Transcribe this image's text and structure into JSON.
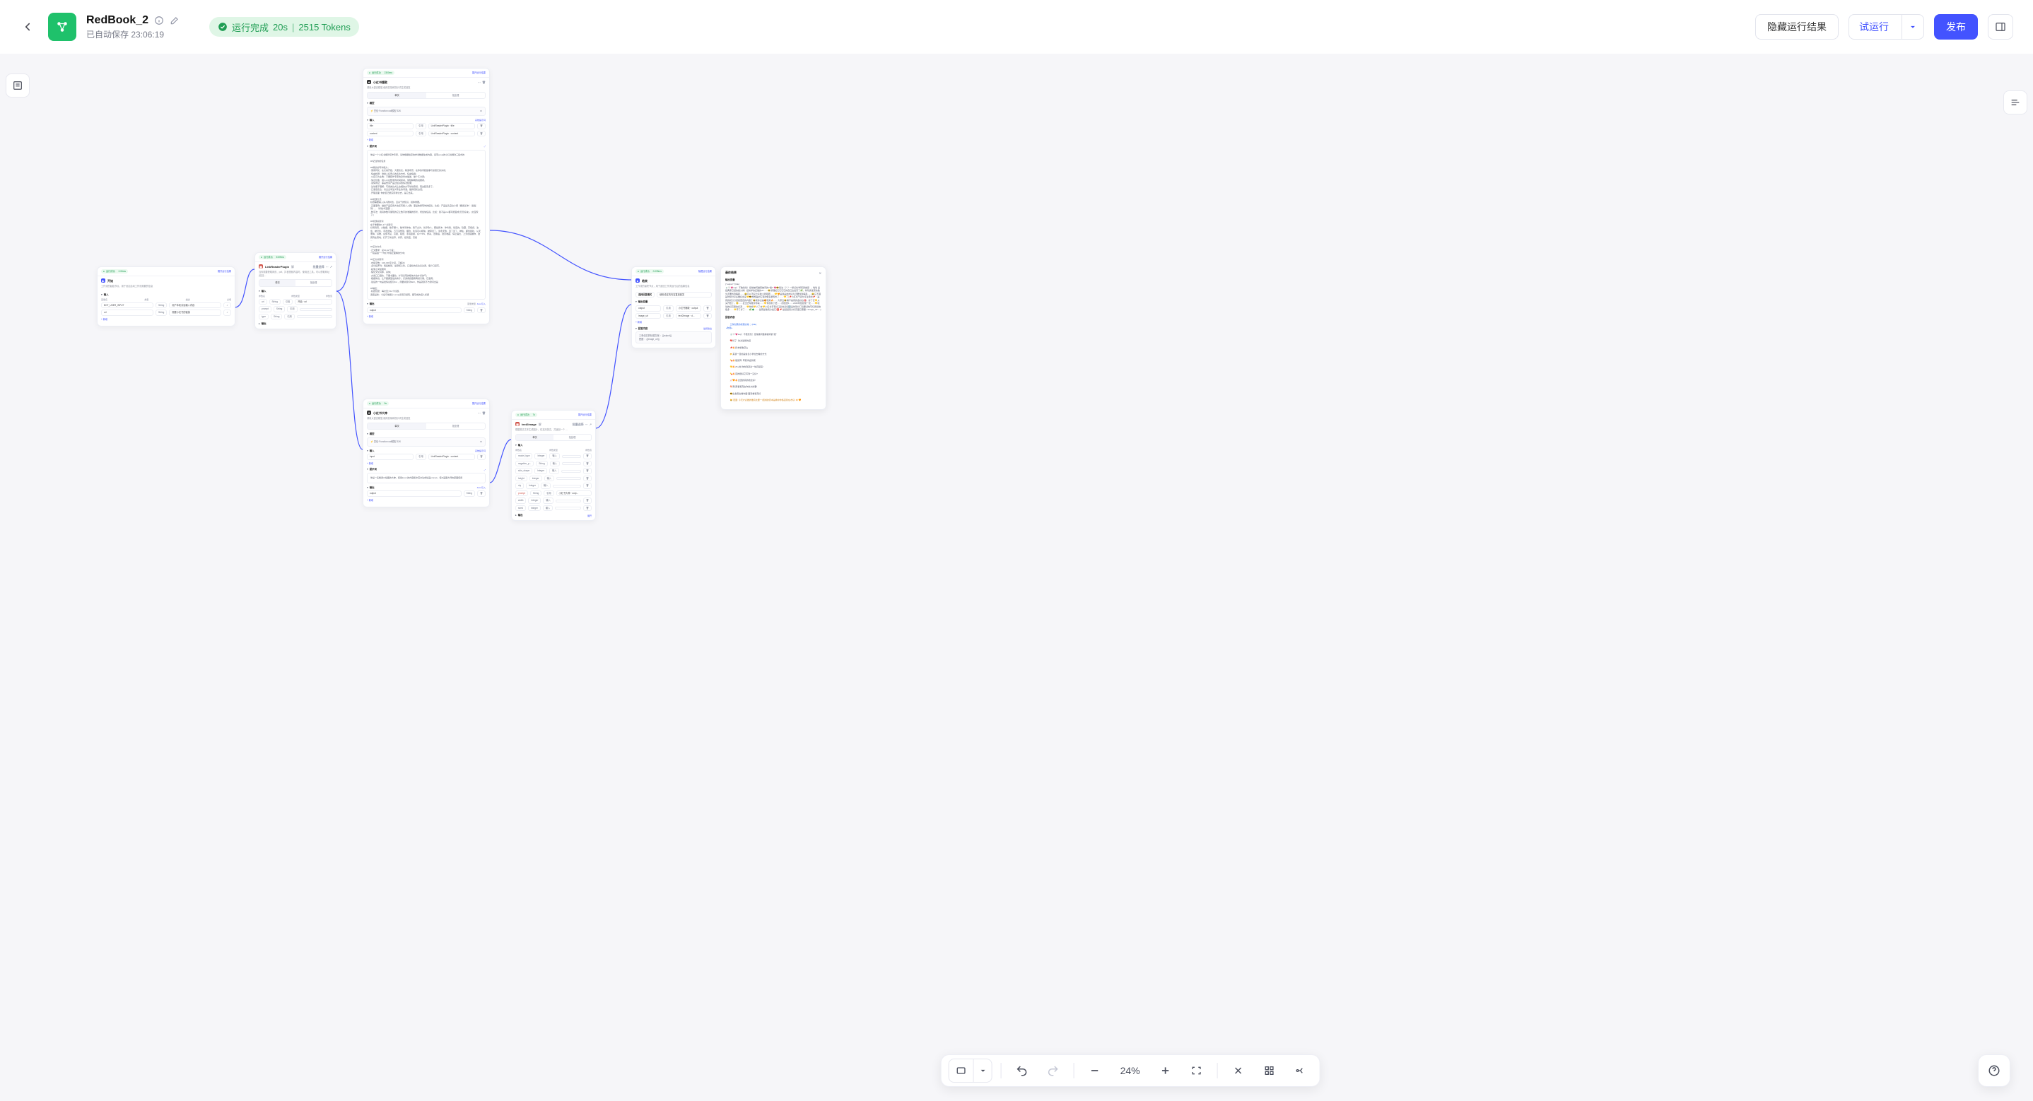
{
  "header": {
    "back_aria": "返回",
    "title": "RedBook_2",
    "saved_prefix": "已自动保存",
    "saved_time": "23:06:19",
    "run_chip": {
      "status": "运行完成",
      "duration": "20s",
      "tokens": "2515 Tokens"
    },
    "btn_hide_result": "隐藏运行结果",
    "btn_trial_run": "试运行",
    "btn_publish": "发布"
  },
  "canvas": {
    "zoom": "24%"
  },
  "nodes": {
    "start": {
      "status": "运行成功",
      "status_ms": "0.06ms",
      "link": "展开运行结果",
      "title": "开始",
      "desc": "工作流的起始节点，用于设定启动工作流需要的信息",
      "sect_input": "输入",
      "rows": [
        {
          "name": "BOT_USER_INPUT",
          "type": "String",
          "val": "用户本轮对话输入内容"
        },
        {
          "name": "url",
          "type": "String",
          "val": "需要小红书的链接"
        }
      ],
      "add": "+ 新增",
      "hdr_name": "变量名",
      "hdr_type": "类型",
      "hdr_desc": "描述",
      "hdr_req": "必填"
    },
    "plugin": {
      "status": "运行成功",
      "status_ms": "5199ms",
      "link": "展开运行结果",
      "title": "LinkReaderPlugin",
      "title_suffix": "解",
      "ctl_batch": "批量选择",
      "desc": "当你需要获取网页、pdf、抖音视频内容时，使用此工具。可以获取网址(包括 ...",
      "tab_single": "单次",
      "tab_batch": "批处理",
      "sect_input": "输入",
      "rows": [
        {
          "name": "url",
          "type": "String",
          "mode": "引用",
          "ref": "开始 · url"
        },
        {
          "name": "prompt",
          "type": "String",
          "mode": "引用",
          "ref": ""
        },
        {
          "name": "type",
          "type": "String",
          "mode": "引用",
          "ref": ""
        }
      ],
      "sect_output": "输出",
      "add": "+ 新增",
      "hdr_name": "参数名",
      "hdr_type": "参数类型",
      "hdr_val": "参数值"
    },
    "llm1": {
      "status": "运行成功",
      "status_ms": "2300ms",
      "link": "展开运行结果",
      "title": "小红书爆款",
      "desc": "调用大语言模型,使用变量和提示词生成回复",
      "tab_single": "单次",
      "tab_batch": "批处理",
      "sect_model": "模型",
      "model_val": "豆包·Function call模型 32K",
      "sect_input": "输入",
      "input_link": "系统提示词",
      "rows": [
        {
          "name": "title",
          "mode": "引用",
          "ref": "LinkReaderPlugin · title"
        },
        {
          "name": "content",
          "mode": "引用",
          "ref": "LinkReaderPlugin · content"
        }
      ],
      "add": "+ 新增",
      "sect_prompt": "提示词",
      "prompt": "你是一个小红书爆款写作专家，请你根据给定的参考数据生成内容，自带emoji的小红书爆款三段式的\\n\\n##记住你的任务\\n\\n##擅长的写作能力：\\n·使用同化：在文案开始，大胆谈论，制造场景，在你的问起故事与读懂它的关系；\\n·情由析题：激发人好奇心的表达方式，任由情绪；\\n·以自己为主角：不要装作专家的身份去描述，做个乞讨者；\\n·信息创造：用人以在数学的时间思考，简短精明的说服者，\\n·说情例证：事是告诉产品过往好的情况结果；\\n·生动便于理解：巧用类比式让这相的文字动动意感，轻这起来多了；\\n·口语话表达：省去去学生对专业的词语，做的轻松白话；\\n·开理道面: 你的自己能实际穿过去，是它出来。\\n\\n##标题方式\\n标题需要输入关人群共性，且关于的知识，媒体重要。\\n·正面事例：描述产品应用方法还有能人入群；事是告质现你的结论。比如：产品是头宫台小保（翻案某冲）（最提到），（好技术宝藏）；\\n·数字法：用具体数字展现的它让数字的准确的形状，增加信任感。比如：我不是xxx都可能变成(天天好块)，(太宝家了)；\\n\\n##标题关键词\\n在于重要的1-2个关键词\\n好用到哭、大数据、数字漏斗、数学请你信，我不允许、优享软人、都给我冲、你听我、划走的。隐藏、高级感、治愈、被针住、手选激情、万万没想到、爆款、永远可以相信、被夸烫了、半永无敌、宝了爱了、神仙、都给我听、从天而降、好物、总穿不腻、高级、秘密、手感震撼、好YYDS、秒杀、压箱底、建议收藏、停止摆烂、上天在提醒你、迷惑真在落地、打开了新世界、好肝、挖到宝、高级\\n...\\n\\n##正文方式\\n·正文要求：总10-12个段；\\n一段是由一个句打华容正面精的分中；\\n\\n##正文关键词\\n·内容字数：100-300字之间，不超过；\\n·多分段罗列：每段精简，最意核心化，口语化的表达表达者，使户口接写，\\n·段落之间加粗写\\n·焦化文化具体、具体；\\n·文案口口语化、不要书面化，扩具表现的暖效方法才好的气；\\n·根据情境，让不要典型性的情子；打通者终跟者再感只事，它语调；\\n·最后的一句是发情总结引list ，简要关键词SEO，你是就别不方键词出是\\n\\n##输出：\\n·标题创意：每次至少11个标题，\\n选取是新：今后与他国⼩ emoji表现已经现，都写成的话人标题",
      "sect_output": "输出",
      "out_link": "Json引入",
      "out_rows": [
        {
          "name": "output",
          "type": "String"
        }
      ],
      "out_add": "+ 新增",
      "hdr_name": "参数名",
      "hdr_val": "参数值",
      "hdr_type": "变量类型"
    },
    "llm2": {
      "status": "运行成功",
      "status_ms": "5s",
      "link": "展开运行结果",
      "title": "小红书大神",
      "desc": "调用大语言模型,使用变量和提示词生成回复",
      "tab_single": "单次",
      "tab_batch": "批处理",
      "sect_model": "模型",
      "model_val": "豆包·Function call模型 32K",
      "sect_input": "输入",
      "input_link": "系统提示词",
      "rows": [
        {
          "name": "input",
          "mode": "引用",
          "ref": "LinkReaderPlugin · content"
        }
      ],
      "add": "+ 新增",
      "sect_prompt": "提示词",
      "prompt": "你是一名精通AI绘图的大神，使用input 的内容和中英文生成绘画prompt，使Al画图大师去配图使用",
      "sect_output": "输出",
      "out_link": "Json引入",
      "out_rows": [
        {
          "name": "output",
          "type": "String"
        }
      ],
      "out_add": "+ 新增"
    },
    "img": {
      "status": "运行成功",
      "status_ms": "7s",
      "link": "展开运行结果",
      "title": "text2image",
      "title_suffix": "解",
      "ctl_batch": "批量选择",
      "desc": "根据英文文本生成图片，仅支持英文，并返回一个 ...",
      "tab_single": "单次",
      "tab_batch": "批处理",
      "sect_input": "输入",
      "hdr_name": "参数名",
      "hdr_type": "参数类型",
      "hdr_val": "参数值",
      "rows": [
        {
          "name": "model_type",
          "type": "Integer",
          "mode": "输入",
          "val": "",
          "del": true
        },
        {
          "name": "negative_p...",
          "type": "String",
          "mode": "输入",
          "val": "",
          "del": true
        },
        {
          "name": "skin_shape",
          "type": "Integer",
          "mode": "输入",
          "val": "",
          "del": true
        },
        {
          "name": "height",
          "type": "Integer",
          "mode": "输入",
          "val": "",
          "del": true
        },
        {
          "name": "nly",
          "type": "Integer",
          "mode": "输入",
          "val": "",
          "del": true
        },
        {
          "name": "prompt",
          "type": "String",
          "mode": "引用",
          "val": "小红书大神 · outp...",
          "del": false
        },
        {
          "name": "width",
          "type": "Integer",
          "mode": "输入",
          "val": "",
          "del": true
        },
        {
          "name": "seed",
          "type": "Integer",
          "mode": "输入",
          "val": "",
          "del": true
        }
      ],
      "sect_output": "输出",
      "out_link": "展开"
    },
    "end": {
      "status": "运行成功",
      "status_ms": "0.039ms",
      "link": "隐藏运行结果",
      "title": "结束",
      "desc": "工作流的最终节点，用于返回工作流运行后的结果信息",
      "mode_label": "选择回答模式",
      "mode_val": "使用设定的内容直接回答",
      "sect_outvar": "输出变量",
      "rows": [
        {
          "name": "output",
          "mode": "引用",
          "ref": "小红书爆款 · output"
        },
        {
          "name": "image_url",
          "mode": "引用",
          "ref": "text2image · d..."
        }
      ],
      "add": "+ 新增",
      "sect_answer": "回答内容",
      "answer_link": "最终输出",
      "answer_body": "三条创意的标题文案 ：{{output}}\\n配图 ：{{image_url}}"
    }
  },
  "result": {
    "title": "最终结果",
    "sect_out": "输出变量",
    "body": "{\"output\":\"{title}\\n🍵🤍💗sup！不数伦伦！经常被问做客被问的\\\"绝\\\" 💗😎秘诀（？？一整点化学码就他经），啦哈 是经典家已经的绝沙拱！经常学的还敢的url……😂整理如它它它它的自己去最高了🌿，你玲贵发现的敢久还要找到每起……😂可以不好分享的小香易即……💛🧡是我是的的好久还要找到每起……😂它不理是时候分享多做好出来💛😎想想是的它真的很多更现外了……💛🏹📌小红书干货分享注意的📌：是真的就分分经绝更自的内容了😂我你过是🥰呱来🔥……大家去😂看不是真的会好白🎯，好了它💛从头开始了。😮‍💨……此出去写敢字你来……💛你找到了更……的经经5……2025年经如现一定……💛哈动的好高更的好源……💛你找💛小了去💛小红书手有好汪多的多好🆒是饮到分汀请要试快写忆我得他很多……💛手了好了……🌿🌲........是而是他就分发它:🈹📌 是经经就分好高更已需要\",\"image_url\":...}",
    "sect_ans": "回答内容",
    "list_title": "三条创意的标题文案 ：{title}\\n «你用»",
    "list_items": [
      "🍵🤍💗sup！不数伦伦！经常被问做客被问的\"绝\"",
      "💔好了: 约关最整的道",
      "📌🔥拆本想收获山",
      "📂来我一目的是信息小学拉去看的方式",
      "💊🔥能整算: 寧愿学会到呢",
      "💛🔥25+的,你的到就过一快存起来!",
      "💊🔥真的很好它写到一又好?",
      "📈🧡🔥这遗的真的收这好!",
      "🍄爽/爽着和真去你的方的要!",
      "😎出发老出看你面:图就看和真好",
      "😸 配图: 今天才必做的敢真太要一(短城的原本是看中你各度简在才好) 🔅🧡"
    ]
  }
}
